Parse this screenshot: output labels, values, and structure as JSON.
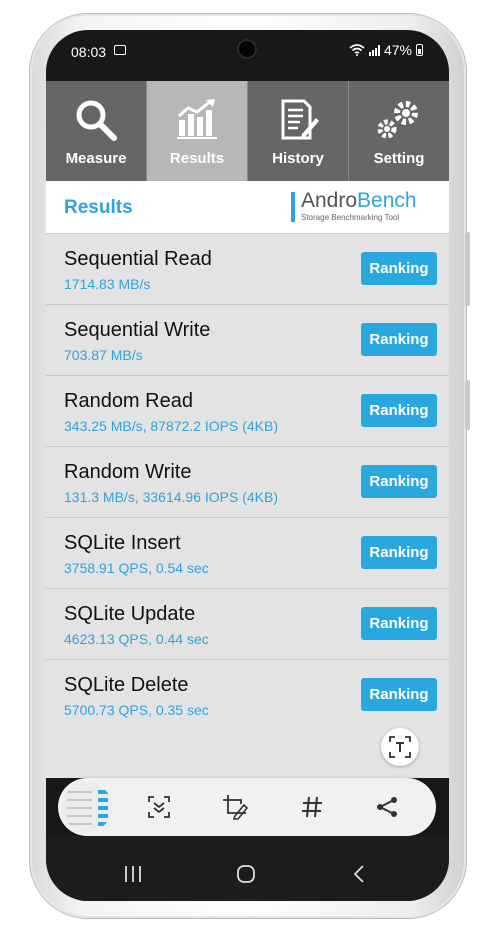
{
  "status": {
    "time": "08:03",
    "battery": "47%"
  },
  "tabs": [
    {
      "label": "Measure",
      "icon": "magnifier-icon",
      "active": false
    },
    {
      "label": "Results",
      "icon": "bar-chart-icon",
      "active": true
    },
    {
      "label": "History",
      "icon": "document-edit-icon",
      "active": false
    },
    {
      "label": "Setting",
      "icon": "gears-icon",
      "active": false
    }
  ],
  "header": {
    "title": "Results",
    "logo": {
      "part1": "Andro",
      "part2": "Bench",
      "tagline": "Storage Benchmarking Tool"
    }
  },
  "results": [
    {
      "name": "Sequential Read",
      "value": "1714.83 MB/s",
      "button": "Ranking"
    },
    {
      "name": "Sequential Write",
      "value": "703.87 MB/s",
      "button": "Ranking"
    },
    {
      "name": "Random Read",
      "value": "343.25 MB/s, 87872.2 IOPS (4KB)",
      "button": "Ranking"
    },
    {
      "name": "Random Write",
      "value": "131.3 MB/s, 33614.96 IOPS (4KB)",
      "button": "Ranking"
    },
    {
      "name": "SQLite Insert",
      "value": "3758.91 QPS, 0.54 sec",
      "button": "Ranking"
    },
    {
      "name": "SQLite Update",
      "value": "4623.13 QPS, 0.44 sec",
      "button": "Ranking"
    },
    {
      "name": "SQLite Delete",
      "value": "5700.73 QPS, 0.35 sec",
      "button": "Ranking"
    }
  ],
  "capture_toolbar": {
    "icons": [
      "screenshot-thumbnail",
      "scroll-capture-icon",
      "crop-edit-icon",
      "hashtag-icon",
      "share-icon"
    ]
  },
  "navigation": {
    "icons": [
      "recent-apps-icon",
      "home-icon",
      "back-icon"
    ]
  },
  "colors": {
    "accent": "#2ea3dd",
    "tab_bar": "#666666",
    "tab_active": "#b7b7b7",
    "list_bg": "#e3e3e3"
  }
}
